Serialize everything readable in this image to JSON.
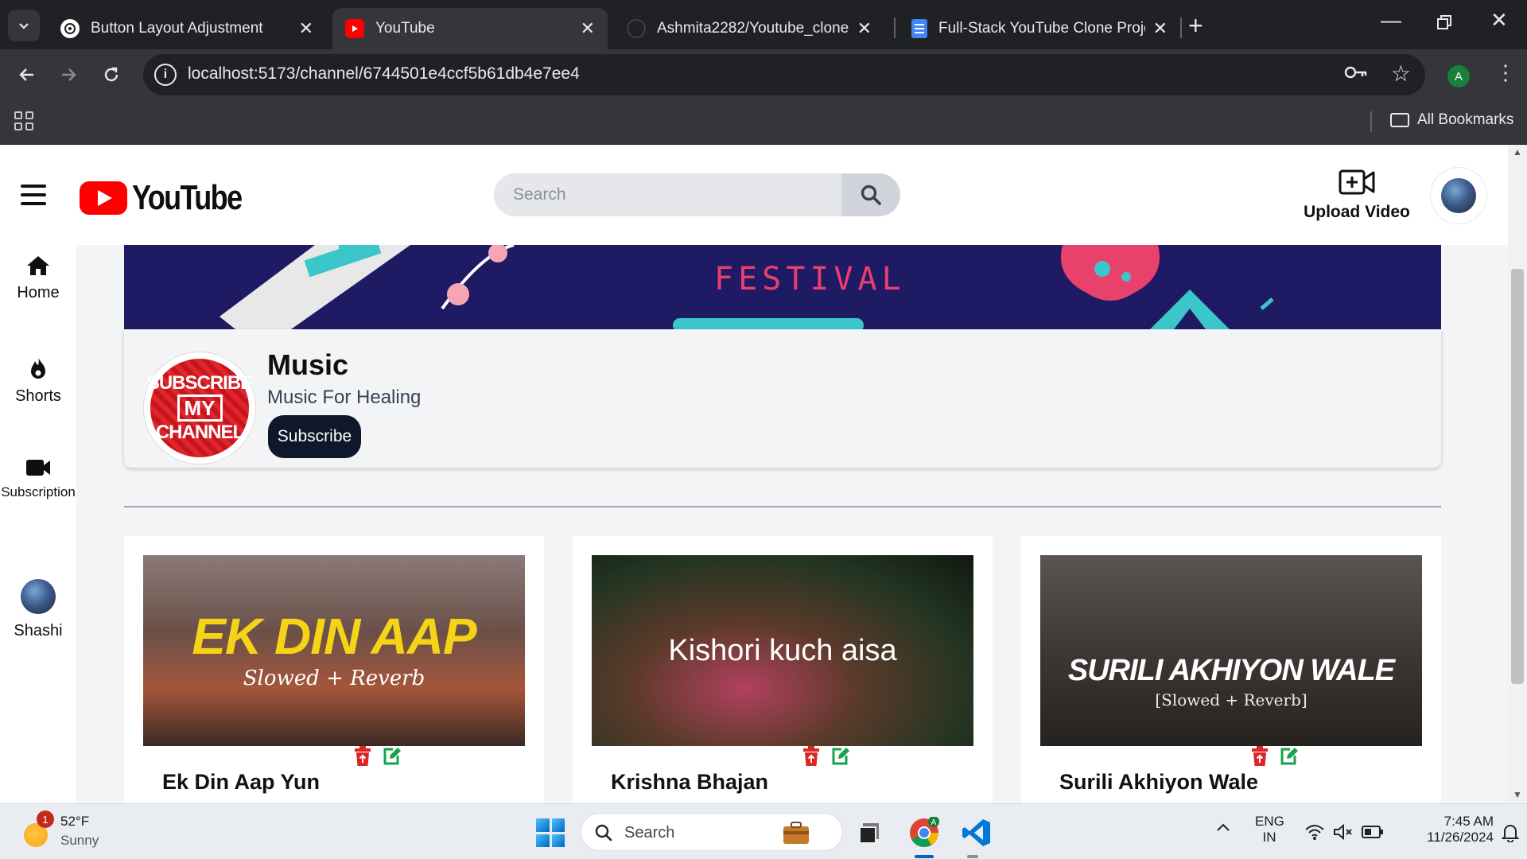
{
  "browser": {
    "tabs": [
      {
        "title": "Button Layout Adjustment",
        "active": false
      },
      {
        "title": "YouTube",
        "active": true
      },
      {
        "title": "Ashmita2282/Youtube_clone",
        "active": false
      },
      {
        "title": "Full-Stack YouTube Clone Proje",
        "active": false
      }
    ],
    "url": "localhost:5173/channel/6744501e4ccf5b61db4e7ee4",
    "profile_initial": "A",
    "all_bookmarks": "All Bookmarks"
  },
  "header": {
    "logo_text": "YouTube",
    "search_placeholder": "Search",
    "upload_label": "Upload Video"
  },
  "sidebar": {
    "items": [
      {
        "label": "Home",
        "icon": "home-icon"
      },
      {
        "label": "Shorts",
        "icon": "flame-icon"
      },
      {
        "label": "Subscription",
        "icon": "video-camera-icon"
      },
      {
        "label": "Shashi",
        "icon": "avatar"
      }
    ]
  },
  "banner": {
    "text": "FESTIVAL"
  },
  "channel": {
    "name": "Music",
    "description": "Music For Healing",
    "subscribe_label": "Subscribe",
    "avatar_lines": [
      "SUBSCRIBE",
      "MY",
      "CHANNEL"
    ]
  },
  "videos": [
    {
      "title": "Ek Din Aap Yun",
      "thumb_title": "EK DIN AAP",
      "thumb_sub": "Slowed + Reverb"
    },
    {
      "title": "Krishna Bhajan",
      "thumb_title": "Kishori kuch aisa",
      "thumb_sub": ""
    },
    {
      "title": "Surili Akhiyon Wale",
      "thumb_title": "SURILI AKHIYON WALE",
      "thumb_sub": "[Slowed + Reverb]"
    }
  ],
  "taskbar": {
    "weather_badge": "1",
    "weather_temp": "52°F",
    "weather_cond": "Sunny",
    "search_label": "Search",
    "lang_line1": "ENG",
    "lang_line2": "IN",
    "time": "7:45 AM",
    "date": "11/26/2024"
  },
  "colors": {
    "brand_red": "#ff0000",
    "subscribe_bg": "#0f172a",
    "delete_red": "#dc2626",
    "edit_green": "#16a34a"
  }
}
